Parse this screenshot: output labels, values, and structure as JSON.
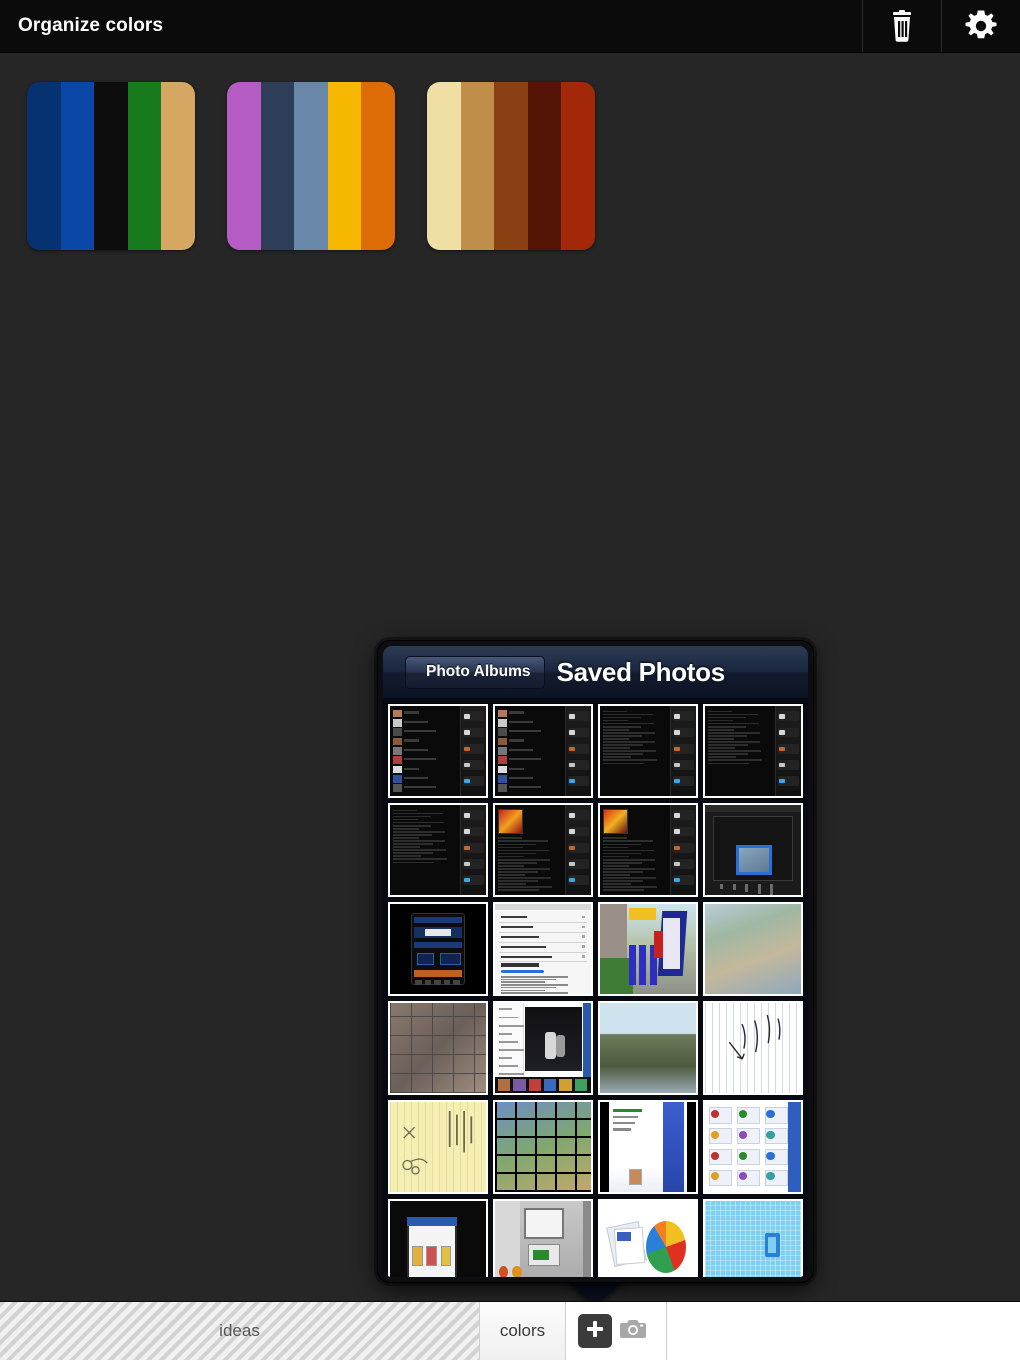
{
  "window": {
    "title": "Organize colors",
    "background": "#262626",
    "topbar_background": "#0b0b0b"
  },
  "topbar": {
    "title": "Organize colors",
    "actions": [
      {
        "name": "trash-icon",
        "label": "Delete"
      },
      {
        "name": "gear-icon",
        "label": "Settings"
      }
    ]
  },
  "palettes": [
    {
      "name": "palette-1",
      "colors": [
        "#063271",
        "#0a47a6",
        "#0d0d0d",
        "#177a1d",
        "#d6a763"
      ]
    },
    {
      "name": "palette-2",
      "colors": [
        "#b55cc5",
        "#2e3e59",
        "#6987a8",
        "#f6b700",
        "#dd6c06"
      ]
    },
    {
      "name": "palette-3",
      "colors": [
        "#f0dfa4",
        "#bf8e4b",
        "#8b4014",
        "#551506",
        "#a32709"
      ]
    }
  ],
  "popover": {
    "back_button": "Photo Albums",
    "title": "Saved Photos",
    "thumbnails": [
      {
        "kind": "dark-list-screenshot",
        "label": "social-feed-screenshot"
      },
      {
        "kind": "dark-list-screenshot",
        "label": "article-thread-screenshot"
      },
      {
        "kind": "dark-text-screenshot",
        "label": "lyrics-text-screenshot"
      },
      {
        "kind": "dark-text-screenshot",
        "label": "article-text-screenshot"
      },
      {
        "kind": "dark-text-screenshot",
        "label": "long-article-screenshot"
      },
      {
        "kind": "dark-album-screenshot",
        "label": "album-art-screenshot"
      },
      {
        "kind": "dark-album-wide",
        "label": "album-detail-screenshot"
      },
      {
        "kind": "dark-editor",
        "label": "photo-editor-screenshot"
      },
      {
        "kind": "dark-app",
        "label": "tracker-app-screenshot"
      },
      {
        "kind": "settings-list",
        "label": "settings-screenshot"
      },
      {
        "kind": "signage",
        "label": "street-signage-photo"
      },
      {
        "kind": "ortho",
        "label": "aerial-map-photo"
      },
      {
        "kind": "photo-wall",
        "label": "photo-grid-screenshot"
      },
      {
        "kind": "night-shot",
        "label": "night-photo-screenshot"
      },
      {
        "kind": "cityscape",
        "label": "landscape-photo"
      },
      {
        "kind": "handwriting",
        "label": "handwritten-note-photo"
      },
      {
        "kind": "yellow-pad",
        "label": "yellow-notepad-photo"
      },
      {
        "kind": "icon-board",
        "label": "icon-grid-screenshot"
      },
      {
        "kind": "web-page",
        "label": "web-page-screenshot"
      },
      {
        "kind": "web-dashboard",
        "label": "dashboard-screenshot"
      },
      {
        "kind": "dark-browser",
        "label": "browser-screenshot"
      },
      {
        "kind": "office-scene",
        "label": "office-photo"
      },
      {
        "kind": "pie-doc",
        "label": "pie-chart-document"
      },
      {
        "kind": "blue-sheet",
        "label": "blue-poster-photo"
      }
    ]
  },
  "tabbar": {
    "tabs": [
      {
        "name": "tab-ideas",
        "label": "ideas",
        "active": false
      },
      {
        "name": "tab-colors",
        "label": "colors",
        "active": true
      }
    ],
    "actions": [
      {
        "name": "add-button",
        "label": "Add"
      },
      {
        "name": "camera-button",
        "label": "Camera"
      }
    ]
  }
}
